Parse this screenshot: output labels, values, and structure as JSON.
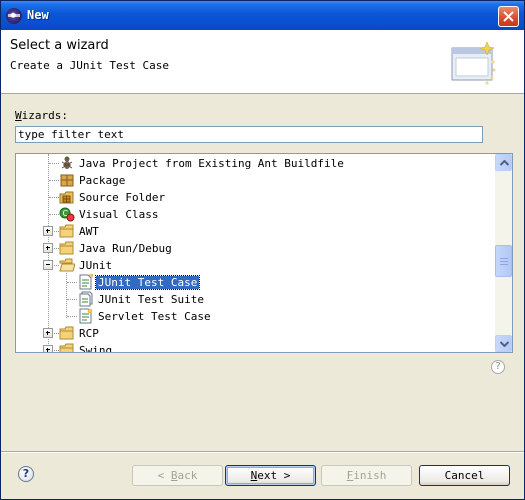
{
  "window": {
    "title": "New"
  },
  "banner": {
    "title": "Select a wizard",
    "subtitle": "Create a JUnit Test Case",
    "icon": "wizard-banner-icon"
  },
  "wizards": {
    "label_mnemonic": "W",
    "label_rest": "izards:"
  },
  "filter": {
    "value": "type filter text"
  },
  "tree": {
    "items": [
      {
        "label": "Java Project from Existing Ant Buildfile",
        "icon": "ant-icon"
      },
      {
        "label": "Package",
        "icon": "package-icon"
      },
      {
        "label": "Source Folder",
        "icon": "source-folder-icon"
      },
      {
        "label": "Visual Class",
        "icon": "visual-class-icon"
      },
      {
        "label": "AWT",
        "icon": "folder-icon",
        "expander": "+"
      },
      {
        "label": "Java Run/Debug",
        "icon": "folder-icon",
        "expander": "+"
      },
      {
        "label": "JUnit",
        "icon": "folder-open-icon",
        "expander": "-"
      },
      {
        "label": "JUnit Test Case",
        "icon": "junit-test-case-icon",
        "selected": true
      },
      {
        "label": "JUnit Test Suite",
        "icon": "junit-test-suite-icon"
      },
      {
        "label": "Servlet Test Case",
        "icon": "servlet-test-case-icon"
      },
      {
        "label": "RCP",
        "icon": "folder-icon",
        "expander": "+"
      },
      {
        "label": "Swing",
        "icon": "folder-icon",
        "expander": "+"
      }
    ]
  },
  "buttons": {
    "back_mnemonic": "B",
    "back_rest": "ack",
    "next_mnemonic": "N",
    "next_rest": "ext >",
    "finish_mnemonic": "F",
    "finish_rest": "inish",
    "cancel": "Cancel"
  },
  "colors": {
    "title_bar": "#0a55d6",
    "selection": "#316ac5",
    "dialog_bg": "#ece9d8"
  }
}
